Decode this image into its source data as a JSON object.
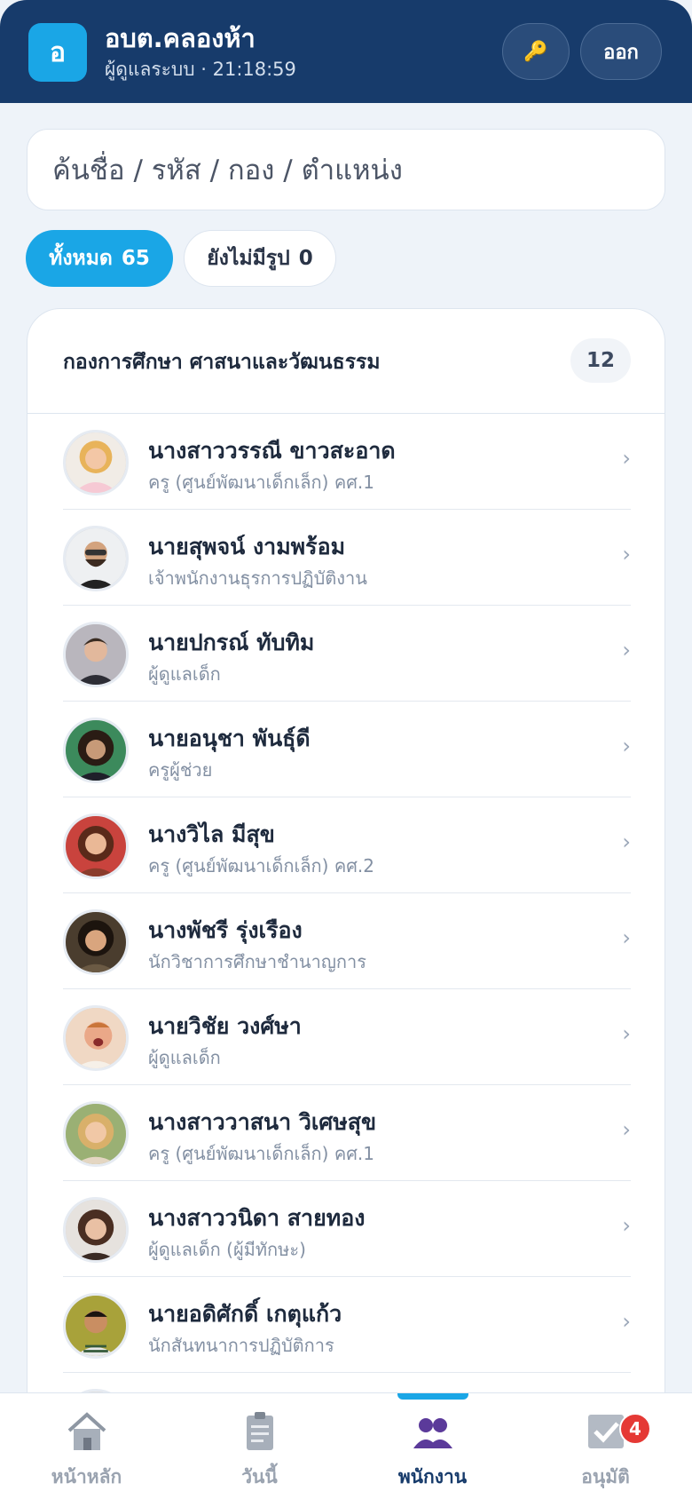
{
  "header": {
    "logo_letter": "อ",
    "title": "อบต.คลองห้า",
    "subtitle": "ผู้ดูแลระบบ · 21:18:59",
    "key_icon": "🔑",
    "logout_label": "ออก"
  },
  "search": {
    "placeholder": "ค้นชื่อ / รหัส / กอง / ตำแหน่ง"
  },
  "filters": {
    "all_label": "ทั้งหมด",
    "all_count": "65",
    "no_photo_label": "ยังไม่มีรูป",
    "no_photo_count": "0"
  },
  "department": {
    "name": "กองการศึกษา ศาสนาและวัฒนธรรม",
    "count": "12"
  },
  "staff": [
    {
      "name": "นางสาววรรณี ขาวสะอาด",
      "role": "ครู (ศูนย์พัฒนาเด็กเล็ก) คศ.1"
    },
    {
      "name": "นายสุพจน์ งามพร้อม",
      "role": "เจ้าพนักงานธุรการปฏิบัติงาน"
    },
    {
      "name": "นายปกรณ์ ทับทิม",
      "role": "ผู้ดูแลเด็ก"
    },
    {
      "name": "นายอนุชา พันธุ์ดี",
      "role": "ครูผู้ช่วย"
    },
    {
      "name": "นางวิไล มีสุข",
      "role": "ครู (ศูนย์พัฒนาเด็กเล็ก) คศ.2"
    },
    {
      "name": "นางพัชรี รุ่งเรือง",
      "role": "นักวิชาการศึกษาชำนาญการ"
    },
    {
      "name": "นายวิชัย วงศ์ษา",
      "role": "ผู้ดูแลเด็ก"
    },
    {
      "name": "นางสาววาสนา วิเศษสุข",
      "role": "ครู (ศูนย์พัฒนาเด็กเล็ก) คศ.1"
    },
    {
      "name": "นางสาววนิดา สายทอง",
      "role": "ผู้ดูแลเด็ก (ผู้มีทักษะ)"
    },
    {
      "name": "นายอดิศักดิ์ เกตุแก้ว",
      "role": "นักสันทนาการปฏิบัติการ"
    }
  ],
  "tabs": [
    {
      "label": "หน้าหลัก",
      "icon": "home-icon"
    },
    {
      "label": "วันนี้",
      "icon": "clipboard-icon"
    },
    {
      "label": "พนักงาน",
      "icon": "people-icon"
    },
    {
      "label": "อนุมัติ",
      "icon": "check-icon"
    }
  ],
  "approve_badge": "4",
  "colors": {
    "header_bg": "#173b6b",
    "accent": "#1aa6e6",
    "badge": "#e53935"
  }
}
